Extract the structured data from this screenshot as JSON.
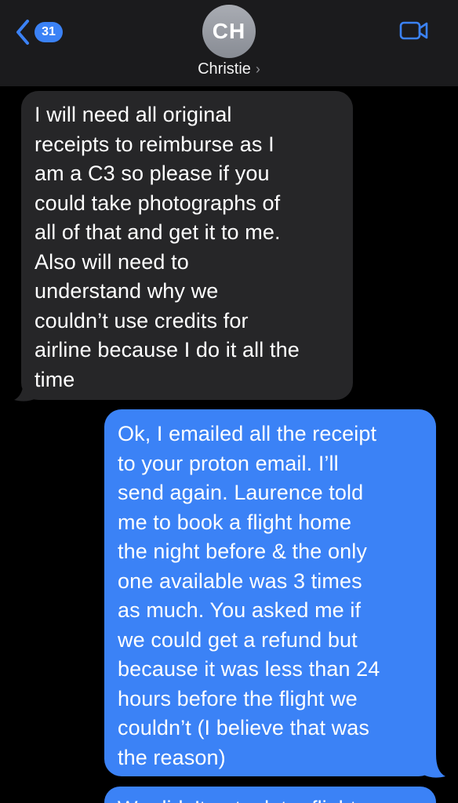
{
  "header": {
    "back_badge_count": "31",
    "avatar_initials": "CH",
    "contact_name": "Christie",
    "contact_chevron": "›",
    "back_icon": "chevron-left-icon",
    "video_icon": "video-camera-icon"
  },
  "colors": {
    "accent": "#3b82f6",
    "incoming_bubble": "#262628",
    "outgoing_bubble": "#3b82f6",
    "header_bg": "#1b1b1d",
    "background": "#000000"
  },
  "messages": [
    {
      "direction": "incoming",
      "text": "I will need all original\nreceipts to reimburse as I\nam a C3 so please if you\ncould take photographs of\nall of that and get it to me.\nAlso will need to\nunderstand why we\ncouldn’t use credits for\nairline because I do it all the\ntime"
    },
    {
      "direction": "outgoing",
      "text": "Ok, I emailed all the receipt\nto your proton email. I’ll\nsend again. Laurence told\nme to book a flight home\nthe night before & the only\none available was 3 times\nas much. You asked me if\nwe could get a refund but\nbecause it was less than 24\nhours before the flight we\ncouldn’t (I believe that was\nthe reason)"
    },
    {
      "direction": "outgoing",
      "text": "We didn’t get a later flight"
    }
  ]
}
